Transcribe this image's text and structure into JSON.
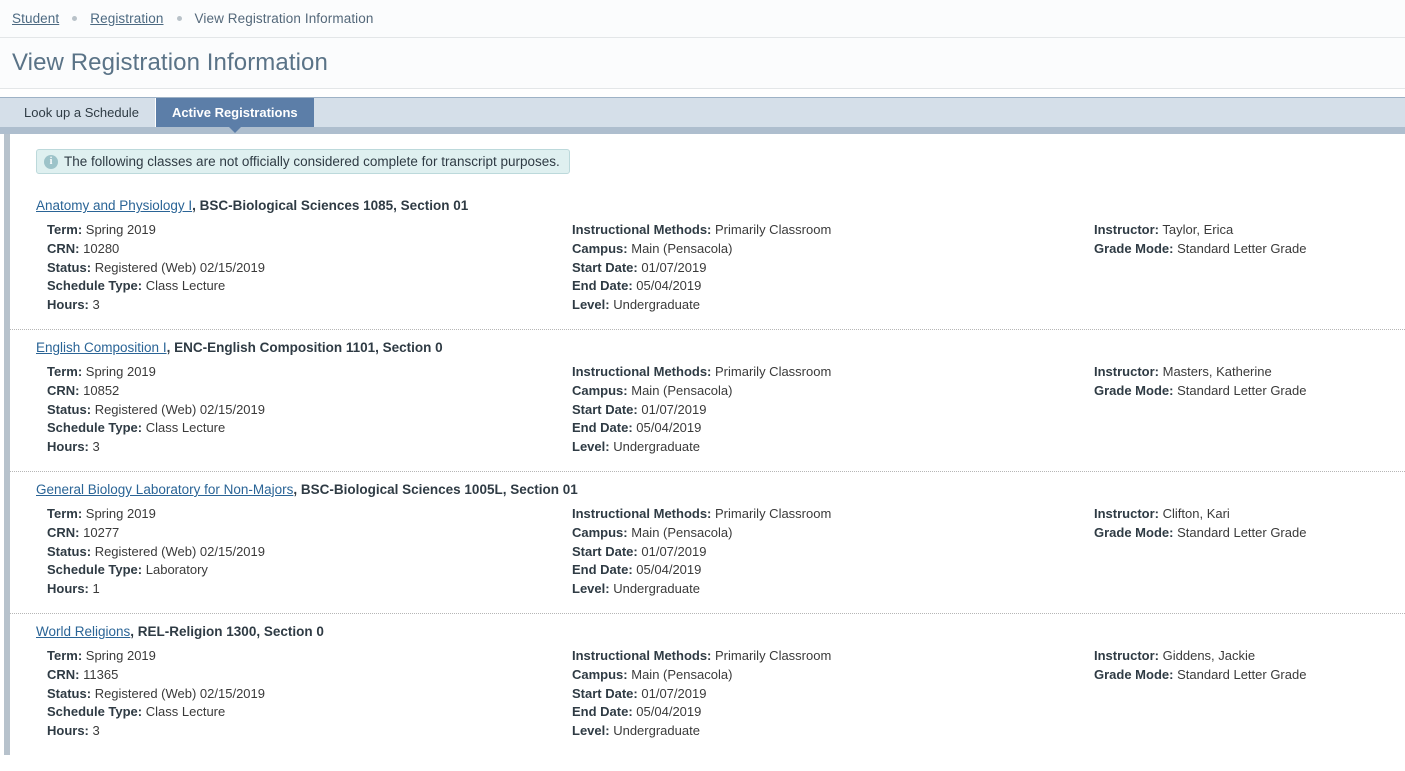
{
  "breadcrumb": {
    "items": [
      {
        "label": "Student",
        "link": true
      },
      {
        "label": "Registration",
        "link": true
      },
      {
        "label": "View Registration Information",
        "link": false
      }
    ]
  },
  "header": {
    "title": "View Registration Information"
  },
  "tabs": [
    {
      "label": "Look up a Schedule",
      "active": false
    },
    {
      "label": "Active Registrations",
      "active": true
    }
  ],
  "info_message": {
    "icon": "info-circle-icon",
    "text": "The following classes are not officially considered complete for transcript purposes."
  },
  "field_labels": {
    "term": "Term:",
    "crn": "CRN:",
    "status": "Status:",
    "schedule_type": "Schedule Type:",
    "hours": "Hours:",
    "instructional_methods": "Instructional Methods:",
    "campus": "Campus:",
    "start_date": "Start Date:",
    "end_date": "End Date:",
    "level": "Level:",
    "instructor": "Instructor:",
    "grade_mode": "Grade Mode:"
  },
  "courses": [
    {
      "title": "Anatomy and Physiology I",
      "meta": ", BSC-Biological Sciences 1085, Section 01",
      "term": "Spring 2019",
      "crn": "10280",
      "status": "Registered (Web) 02/15/2019",
      "schedule_type": "Class Lecture",
      "hours": "3",
      "instructional_methods": "Primarily Classroom",
      "campus": "Main (Pensacola)",
      "start_date": "01/07/2019",
      "end_date": "05/04/2019",
      "level": "Undergraduate",
      "instructor": "Taylor, Erica",
      "grade_mode": "Standard Letter Grade"
    },
    {
      "title": "English Composition I",
      "meta": ", ENC-English Composition 1101, Section 0",
      "term": "Spring 2019",
      "crn": "10852",
      "status": "Registered (Web) 02/15/2019",
      "schedule_type": "Class Lecture",
      "hours": "3",
      "instructional_methods": "Primarily Classroom",
      "campus": "Main (Pensacola)",
      "start_date": "01/07/2019",
      "end_date": "05/04/2019",
      "level": "Undergraduate",
      "instructor": "Masters, Katherine",
      "grade_mode": "Standard Letter Grade"
    },
    {
      "title": "General Biology Laboratory for Non-Majors",
      "meta": ", BSC-Biological Sciences 1005L, Section 01",
      "term": "Spring 2019",
      "crn": "10277",
      "status": "Registered (Web) 02/15/2019",
      "schedule_type": "Laboratory",
      "hours": "1",
      "instructional_methods": "Primarily Classroom",
      "campus": "Main (Pensacola)",
      "start_date": "01/07/2019",
      "end_date": "05/04/2019",
      "level": "Undergraduate",
      "instructor": "Clifton, Kari",
      "grade_mode": "Standard Letter Grade"
    },
    {
      "title": "World Religions",
      "meta": ", REL-Religion 1300, Section 0",
      "term": "Spring 2019",
      "crn": "11365",
      "status": "Registered (Web) 02/15/2019",
      "schedule_type": "Class Lecture",
      "hours": "3",
      "instructional_methods": "Primarily Classroom",
      "campus": "Main (Pensacola)",
      "start_date": "01/07/2019",
      "end_date": "05/04/2019",
      "level": "Undergraduate",
      "instructor": "Giddens, Jackie",
      "grade_mode": "Standard Letter Grade"
    }
  ],
  "colors": {
    "tab_active_bg": "#5c7ea8",
    "tab_strip_bg": "#d5dfe9",
    "tab_underline": "#aebece",
    "panel_rail": "#b7c2cc",
    "info_bg": "#dff0f0",
    "info_border": "#bcd9db",
    "link": "#2a6496",
    "title": "#5a7387"
  }
}
